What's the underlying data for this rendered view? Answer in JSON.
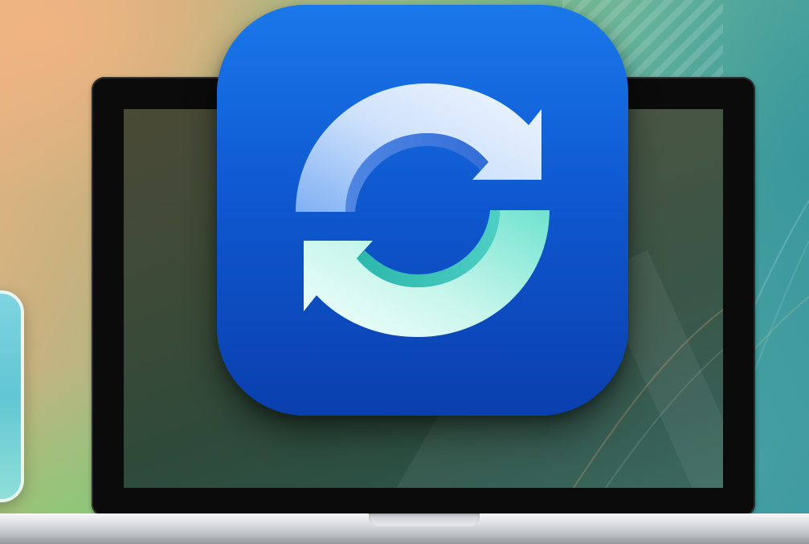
{
  "scene": {
    "app_icon": {
      "icon": "sync-arrows-icon",
      "colors": {
        "tile_top": "#1a78ea",
        "tile_bottom": "#0a3fae",
        "arrow_top": "#dbeafd",
        "arrow_bottom": "#e6fbf5",
        "arrow_teal": "#4fd8bf"
      }
    },
    "device": "laptop",
    "side_tile": "app-tile"
  }
}
